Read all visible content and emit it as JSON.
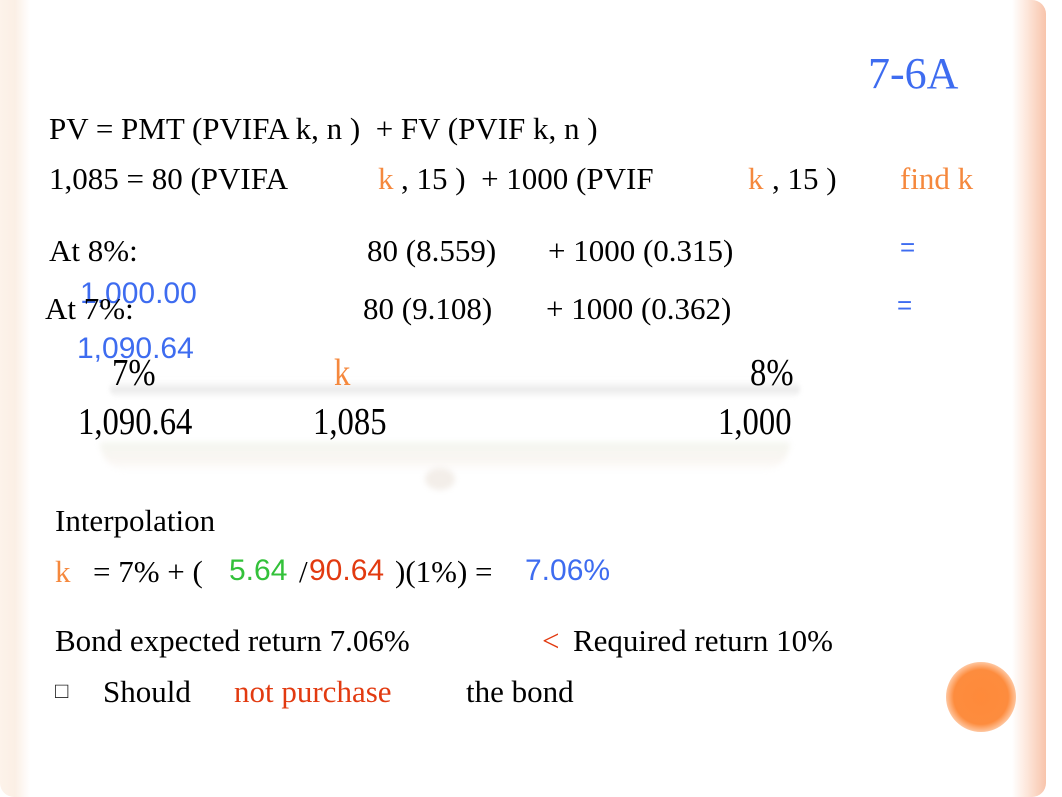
{
  "slide": {
    "title": "7-6A",
    "formula_general": "PV = PMT (PVIFA k, n )  + FV (PVIF k, n )",
    "formula_specific": {
      "part1": "1,085 = 80 (PVIFA",
      "k1": "k",
      "part2": ", 15 )  + 1000 (PVIF",
      "k2": "k",
      "part3": ", 15 )",
      "note": "find k"
    },
    "trial_rows": [
      {
        "label": "At 8%:",
        "pvifa_term": "80 (8.559)",
        "pvif_term": "+ 1000 (0.315)",
        "equals": "=",
        "result": "1,000.00"
      },
      {
        "label": "At 7%:",
        "pvifa_term": "80 (9.108)",
        "pvif_term": "+ 1000 (0.362)",
        "equals": "=",
        "result": "1,090.64"
      }
    ],
    "interpolation_table": {
      "rates": [
        "7%",
        "k",
        "8%"
      ],
      "values": [
        "1,090.64",
        "1,085",
        "1,000"
      ]
    },
    "interpolation": {
      "heading": "Interpolation",
      "k": "k",
      "expr_start": "= 7% + (",
      "numerator": "5.64",
      "slash": "/",
      "denominator": "90.64",
      "expr_end": ")(1%) =",
      "result": "7.06%"
    },
    "conclusion": {
      "comparison_left": "Bond expected return 7.06%",
      "less_than": "<",
      "comparison_right": "Required return 10%",
      "bullet_icon": "□",
      "should": "Should",
      "not_purchase": "not purchase",
      "the_bond": "the bond"
    },
    "colors": {
      "blue": "#3e6cf0",
      "orange": "#f5883d",
      "green": "#33c13a",
      "red": "#e23a10",
      "decor_orange": "#fd8c3e"
    }
  }
}
